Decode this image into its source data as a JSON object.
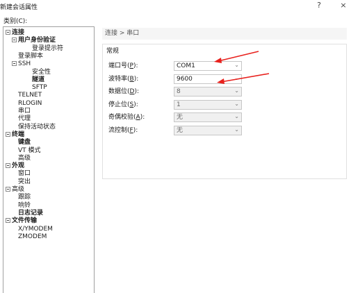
{
  "window": {
    "title": "新建会话属性",
    "help_label": "?",
    "close_label": "×"
  },
  "category": {
    "label": "类别(C):",
    "tree": [
      {
        "label": "连接",
        "level": 0,
        "bold": true,
        "expander": true
      },
      {
        "label": "用户身份验证",
        "level": 1,
        "bold": true,
        "expander": true
      },
      {
        "label": "登录提示符",
        "level": 2,
        "bold": false,
        "expander": false
      },
      {
        "label": "登录脚本",
        "level": 1,
        "bold": false,
        "expander": false
      },
      {
        "label": "SSH",
        "level": 1,
        "bold": false,
        "expander": true
      },
      {
        "label": "安全性",
        "level": 2,
        "bold": false,
        "expander": false
      },
      {
        "label": "隧道",
        "level": 2,
        "bold": true,
        "expander": false
      },
      {
        "label": "SFTP",
        "level": 2,
        "bold": false,
        "expander": false
      },
      {
        "label": "TELNET",
        "level": 1,
        "bold": false,
        "expander": false
      },
      {
        "label": "RLOGIN",
        "level": 1,
        "bold": false,
        "expander": false
      },
      {
        "label": "串口",
        "level": 1,
        "bold": false,
        "expander": false
      },
      {
        "label": "代理",
        "level": 1,
        "bold": false,
        "expander": false
      },
      {
        "label": "保持活动状态",
        "level": 1,
        "bold": false,
        "expander": false
      },
      {
        "label": "终端",
        "level": 0,
        "bold": true,
        "expander": true
      },
      {
        "label": "键盘",
        "level": 1,
        "bold": true,
        "expander": false
      },
      {
        "label": "VT 模式",
        "level": 1,
        "bold": false,
        "expander": false
      },
      {
        "label": "高级",
        "level": 1,
        "bold": false,
        "expander": false
      },
      {
        "label": "外观",
        "level": 0,
        "bold": true,
        "expander": true
      },
      {
        "label": "窗口",
        "level": 1,
        "bold": false,
        "expander": false
      },
      {
        "label": "突出",
        "level": 1,
        "bold": false,
        "expander": false
      },
      {
        "label": "高级",
        "level": 0,
        "bold": false,
        "expander": true
      },
      {
        "label": "跟踪",
        "level": 1,
        "bold": false,
        "expander": false
      },
      {
        "label": "响铃",
        "level": 1,
        "bold": false,
        "expander": false
      },
      {
        "label": "日志记录",
        "level": 1,
        "bold": true,
        "expander": false
      },
      {
        "label": "文件传输",
        "level": 0,
        "bold": true,
        "expander": true
      },
      {
        "label": "X/YMODEM",
        "level": 1,
        "bold": false,
        "expander": false
      },
      {
        "label": "ZMODEM",
        "level": 1,
        "bold": false,
        "expander": false
      }
    ]
  },
  "panel": {
    "breadcrumb": "连接 > 串口",
    "group_label": "常规",
    "fields": [
      {
        "label_prefix": "端口号(",
        "key": "P",
        "label_suffix": "):",
        "value": "COM1",
        "enabled": true
      },
      {
        "label_prefix": "波特率(",
        "key": "B",
        "label_suffix": "):",
        "value": "9600",
        "enabled": true
      },
      {
        "label_prefix": "数据位(",
        "key": "D",
        "label_suffix": "):",
        "value": "8",
        "enabled": false
      },
      {
        "label_prefix": "停止位(",
        "key": "S",
        "label_suffix": "):",
        "value": "1",
        "enabled": false
      },
      {
        "label_prefix": "奇偶校验(",
        "key": "A",
        "label_suffix": "):",
        "value": "无",
        "enabled": false
      },
      {
        "label_prefix": "流控制(",
        "key": "F",
        "label_suffix": "):",
        "value": "无",
        "enabled": false
      }
    ]
  },
  "colors": {
    "annotation_arrow": "#e8201c",
    "panel_background": "#ffffff",
    "disabled_field": "#f0f0f0"
  }
}
